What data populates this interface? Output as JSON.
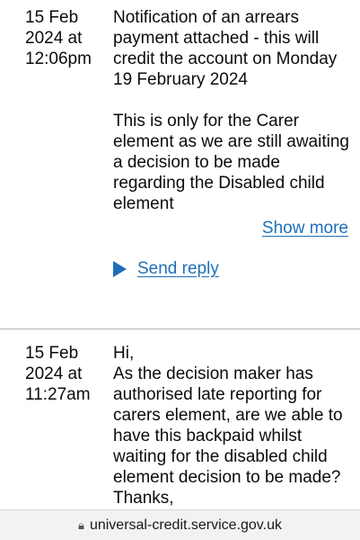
{
  "messages": [
    {
      "date": "15 Feb 2024 at 12:06pm",
      "paragraphs": [
        "Notification of an arrears payment attached - this will credit the account on Monday 19 February 2024",
        "This is only for the Carer element as we are still awaiting a decision to be made regarding the Disabled child element"
      ],
      "show_more": "Show more",
      "send_reply": "Send reply"
    },
    {
      "date": "15 Feb 2024 at 11:27am",
      "lines": [
        "Hi,",
        "As the decision maker has authorised late reporting for carers element, are we able to have this backpaid whilst waiting for the disabled child element decision to be made?",
        "Thanks,"
      ]
    }
  ],
  "browser": {
    "url": "universal-credit.service.gov.uk",
    "lock_icon": "lock-icon"
  }
}
